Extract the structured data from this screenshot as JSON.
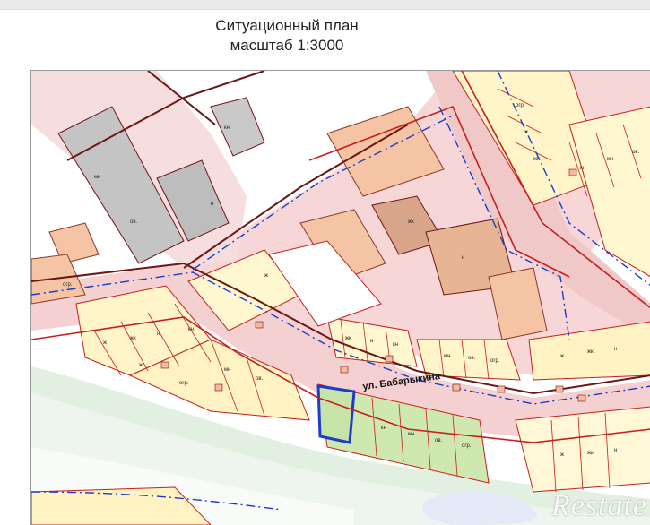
{
  "title": {
    "line1": "Ситуационный план",
    "line2": "масштаб 1:3000"
  },
  "map": {
    "street_label": "ул. Бабарыкина",
    "zone_labels": [
      "ж",
      "жк",
      "н",
      "кн",
      "мн",
      "ов.",
      "огр."
    ],
    "colors": {
      "road": "#f6d6d6",
      "building": "#f4c4a4",
      "building_dark": "#d9a58a",
      "grey_block": "#bfbfbf",
      "boundary_red": "#c81e1e",
      "boundary_dark": "#6e1515",
      "boundary_blue": "#1e3cc8",
      "river": "#ddeedd",
      "water": "#e6ebf7",
      "green_parcel": "#cfe8b0",
      "highlight_yellow": "#fff59e"
    }
  },
  "watermark": "Restate"
}
